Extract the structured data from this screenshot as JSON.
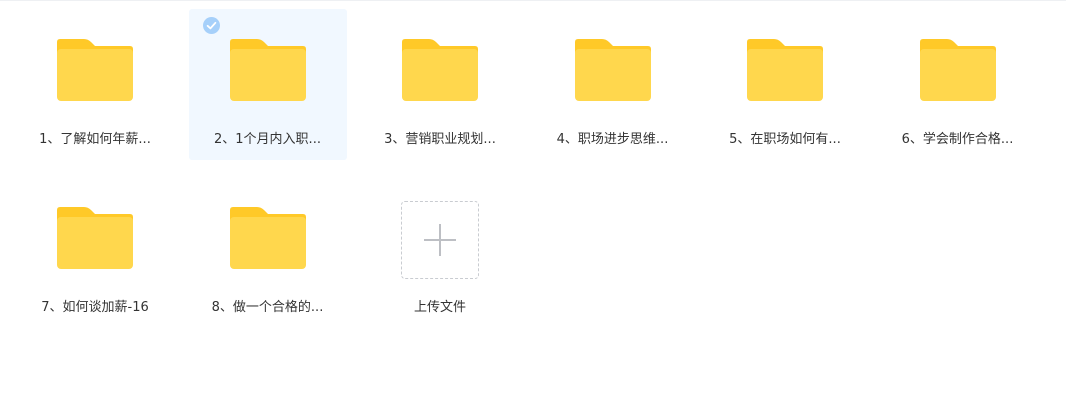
{
  "folders": [
    {
      "name": "1、了解如何年薪...",
      "selected": false
    },
    {
      "name": "2、1个月内入职...",
      "selected": true
    },
    {
      "name": "3、营销职业规划...",
      "selected": false
    },
    {
      "name": "4、职场进步思维...",
      "selected": false
    },
    {
      "name": "5、在职场如何有...",
      "selected": false
    },
    {
      "name": "6、学会制作合格...",
      "selected": false
    },
    {
      "name": "7、如何谈加薪-16",
      "selected": false
    },
    {
      "name": "8、做一个合格的...",
      "selected": false
    }
  ],
  "upload": {
    "label": "上传文件",
    "icon": "plus-icon"
  },
  "colors": {
    "folder_body": "#FFD74D",
    "folder_tab": "#FFC928",
    "selected_bg": "#F1F8FF",
    "check_badge": "#A6D0FA",
    "label_text": "#333333",
    "upload_border": "#C9CCD1",
    "upload_plus": "#BDBFC4"
  }
}
